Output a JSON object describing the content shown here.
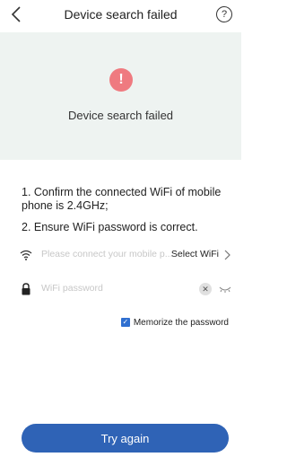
{
  "header": {
    "title": "Device search failed",
    "back_icon": "chevron-left-icon",
    "help_icon": "question-circle-icon",
    "help_glyph": "?"
  },
  "status": {
    "icon": "error-exclamation-icon",
    "icon_glyph": "!",
    "icon_color": "#ef7a80",
    "message": "Device search failed",
    "panel_color": "#eef3f1"
  },
  "instructions": [
    "1. Confirm the connected WiFi of mobile phone is 2.4GHz;",
    "2. Ensure WiFi password is correct."
  ],
  "wifi_field": {
    "icon": "wifi-icon",
    "placeholder": "Please connect your mobile p...",
    "action_label": "Select WiFi",
    "action_icon": "chevron-right-icon"
  },
  "password_field": {
    "icon": "lock-icon",
    "placeholder": "WiFi password",
    "clear_icon": "clear-icon",
    "clear_glyph": "✕",
    "visibility_icon": "eye-closed-icon"
  },
  "memorize": {
    "checked": true,
    "check_glyph": "✓",
    "label": "Memorize the password"
  },
  "primary_button": {
    "label": "Try again",
    "color": "#2f63b6"
  }
}
